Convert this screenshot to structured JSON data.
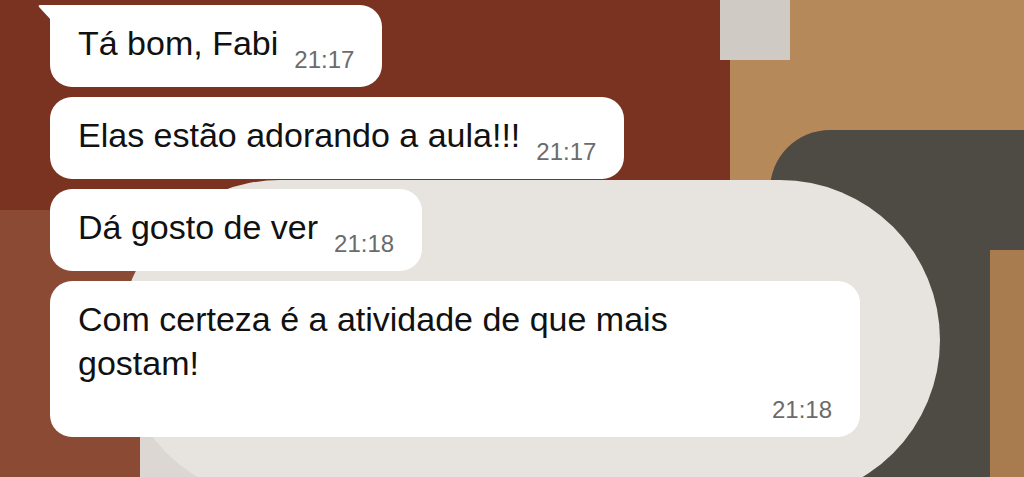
{
  "messages": [
    {
      "text": "Tá bom, Fabi",
      "time": "21:17",
      "tail": true
    },
    {
      "text": "Elas estão adorando a aula!!!",
      "time": "21:17",
      "tail": false
    },
    {
      "text": "Dá gosto de ver",
      "time": "21:18",
      "tail": false
    },
    {
      "text": "Com certeza é a atividade de que mais gostam!",
      "time": "21:18",
      "tail": false
    }
  ]
}
